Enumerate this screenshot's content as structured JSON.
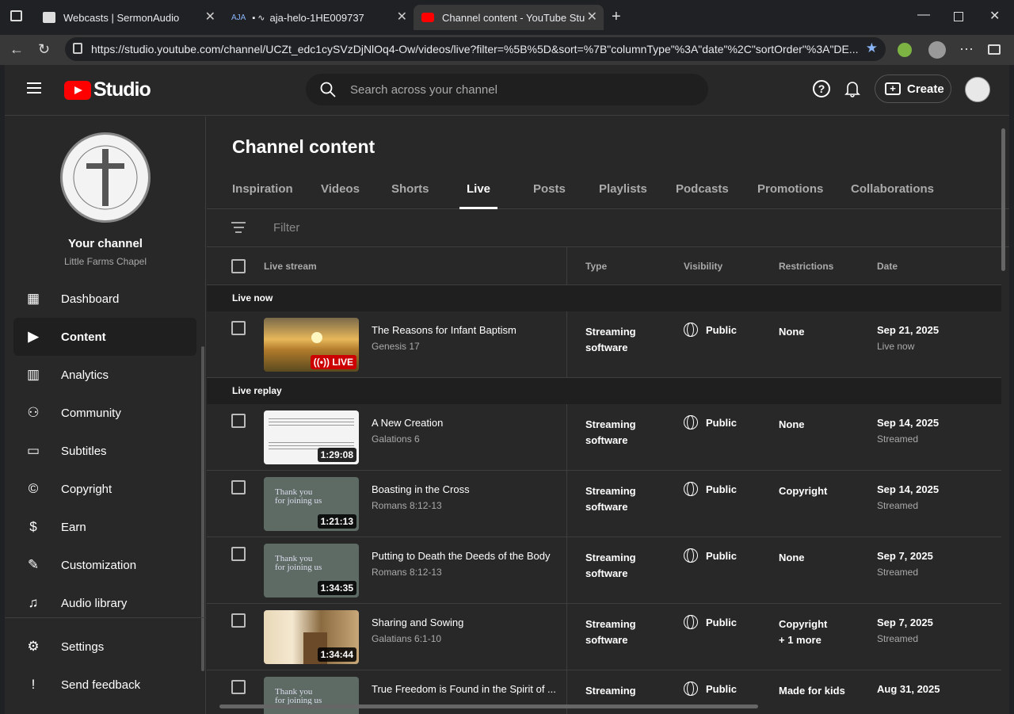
{
  "browser": {
    "tabs": [
      {
        "title": "Webcasts | SermonAudio"
      },
      {
        "title": "aja-helo-1HE009737"
      },
      {
        "title": "Channel content - YouTube Studio"
      }
    ],
    "url": "https://studio.youtube.com/channel/UCZt_edc1cySVzDjNlOq4-Ow/videos/live?filter=%5B%5D&sort=%7B\"columnType\"%3A\"date\"%2C\"sortOrder\"%3A\"DE..."
  },
  "header": {
    "logo_text": "Studio",
    "search_placeholder": "Search across your channel",
    "create_label": "Create"
  },
  "sidebar": {
    "channel_title": "Your channel",
    "channel_name": "Little Farms Chapel",
    "items": [
      {
        "label": "Dashboard",
        "icon": "dashboard-icon"
      },
      {
        "label": "Content",
        "icon": "content-icon"
      },
      {
        "label": "Analytics",
        "icon": "analytics-icon"
      },
      {
        "label": "Community",
        "icon": "community-icon"
      },
      {
        "label": "Subtitles",
        "icon": "subtitles-icon"
      },
      {
        "label": "Copyright",
        "icon": "copyright-icon"
      },
      {
        "label": "Earn",
        "icon": "earn-icon"
      },
      {
        "label": "Customization",
        "icon": "customization-icon"
      },
      {
        "label": "Audio library",
        "icon": "audio-library-icon"
      }
    ],
    "settings_label": "Settings",
    "feedback_label": "Send feedback"
  },
  "main": {
    "title": "Channel content",
    "tabs": [
      "Inspiration",
      "Videos",
      "Shorts",
      "Live",
      "Posts",
      "Playlists",
      "Podcasts",
      "Promotions",
      "Collaborations"
    ],
    "active_tab": "Live",
    "filter_placeholder": "Filter",
    "columns": {
      "stream": "Live stream",
      "type": "Type",
      "visibility": "Visibility",
      "restrictions": "Restrictions",
      "date": "Date"
    },
    "section_live": "Live now",
    "section_replay": "Live replay",
    "live_badge": "LIVE",
    "live_row": {
      "title": "The Reasons for Infant Baptism",
      "subtitle": "Genesis 17",
      "type1": "Streaming",
      "type2": "software",
      "visibility": "Public",
      "restrictions": "None",
      "date": "Sep 21, 2025",
      "date_sub": "Live now"
    },
    "rows": [
      {
        "title": "A New Creation",
        "subtitle": "Galations 6",
        "duration": "1:29:08",
        "type1": "Streaming",
        "type2": "software",
        "visibility": "Public",
        "restr1": "None",
        "restr2": "",
        "date": "Sep 14, 2025",
        "date_sub": "Streamed",
        "thumb": "sheet"
      },
      {
        "title": "Boasting in the Cross",
        "subtitle": "Romans 8:12-13",
        "duration": "1:21:13",
        "type1": "Streaming",
        "type2": "software",
        "visibility": "Public",
        "restr1": "Copyright",
        "restr2": "",
        "date": "Sep 14, 2025",
        "date_sub": "Streamed",
        "thumb": "thanks"
      },
      {
        "title": "Putting to Death the Deeds of the Body",
        "subtitle": "Romans 8:12-13",
        "duration": "1:34:35",
        "type1": "Streaming",
        "type2": "software",
        "visibility": "Public",
        "restr1": "None",
        "restr2": "",
        "date": "Sep 7, 2025",
        "date_sub": "Streamed",
        "thumb": "thanks"
      },
      {
        "title": "Sharing and Sowing",
        "subtitle": "Galatians 6:1-10",
        "duration": "1:34:44",
        "type1": "Streaming",
        "type2": "software",
        "visibility": "Public",
        "restr1": "Copyright",
        "restr2": "+ 1 more",
        "date": "Sep 7, 2025",
        "date_sub": "Streamed",
        "thumb": "pulpit"
      },
      {
        "title": "True Freedom is Found in the Spirit of ...",
        "subtitle": "",
        "duration": "",
        "type1": "Streaming",
        "type2": "",
        "visibility": "Public",
        "restr1": "Made for kids",
        "restr2": "",
        "date": "Aug 31, 2025",
        "date_sub": "",
        "thumb": "thanks"
      }
    ],
    "thumb_text1": "Thank you",
    "thumb_text2": "for joining us"
  }
}
